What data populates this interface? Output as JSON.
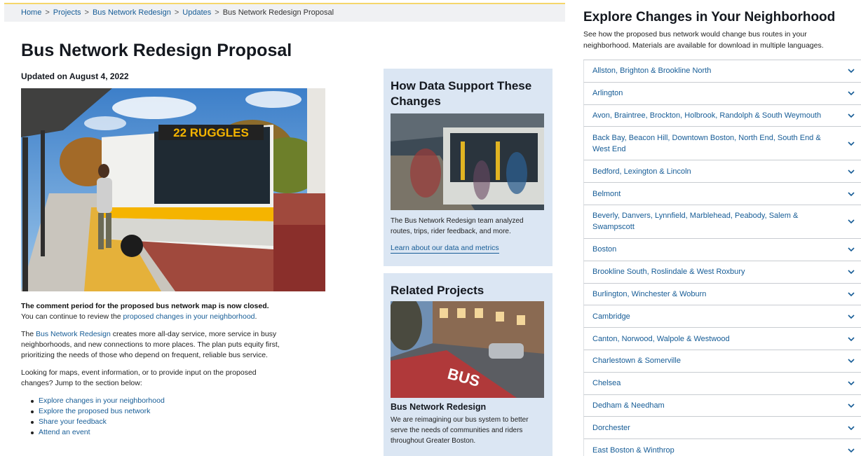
{
  "breadcrumb": {
    "items": [
      "Home",
      "Projects",
      "Bus Network Redesign",
      "Updates"
    ],
    "current": "Bus Network Redesign Proposal"
  },
  "page": {
    "title": "Bus Network Redesign Proposal",
    "updated": "Updated on August 4, 2022",
    "hero_sign": "22 RUGGLES"
  },
  "intro": {
    "closed_bold": "The comment period for the proposed bus network map is now closed.",
    "closed_rest": " You can continue to review the ",
    "closed_link": "proposed changes in your neighborhood",
    "closed_end": ".",
    "p2_pre": "The ",
    "p2_link": "Bus Network Redesign",
    "p2_rest": " creates more all-day service, more service in busy neighborhoods, and new connections to more places. The plan puts equity first, prioritizing the needs of those who depend on frequent, reliable bus service.",
    "p3": "Looking for maps, event information, or to provide input on the proposed changes? Jump to the section below:",
    "jump_links": [
      "Explore changes in your neighborhood",
      "Explore the proposed bus network",
      "Share your feedback",
      "Attend an event"
    ]
  },
  "data_card": {
    "title": "How Data Support These Changes",
    "desc": "The Bus Network Redesign team analyzed routes, trips, rider feedback, and more.",
    "link": "Learn about our data and metrics"
  },
  "related_card": {
    "title": "Related Projects",
    "project_title": "Bus Network Redesign",
    "project_desc": "We are reimagining our bus system to better serve the needs of communities and riders throughout Greater Boston.",
    "road_text": "BUS"
  },
  "explore": {
    "title": "Explore Changes in Your Neighborhood",
    "desc": "See how the proposed bus network would change bus routes in your neighborhood. Materials are available for download in multiple languages.",
    "neighborhoods": [
      "Allston, Brighton & Brookline North",
      "Arlington",
      "Avon, Braintree, Brockton, Holbrook, Randolph & South Weymouth",
      "Back Bay, Beacon Hill, Downtown Boston, North End, South End & West End",
      "Bedford, Lexington & Lincoln",
      "Belmont",
      "Beverly, Danvers, Lynnfield, Marblehead, Peabody, Salem & Swampscott",
      "Boston",
      "Brookline South, Roslindale & West Roxbury",
      "Burlington, Winchester & Woburn",
      "Cambridge",
      "Canton, Norwood, Walpole & Westwood",
      "Charlestown & Somerville",
      "Chelsea",
      "Dedham & Needham",
      "Dorchester",
      "East Boston & Winthrop"
    ]
  },
  "colors": {
    "link": "#165c96",
    "card_bg": "#dbe6f3",
    "breadcrumb_bg": "#f0f1f3",
    "bus_accent": "#f5b400"
  }
}
